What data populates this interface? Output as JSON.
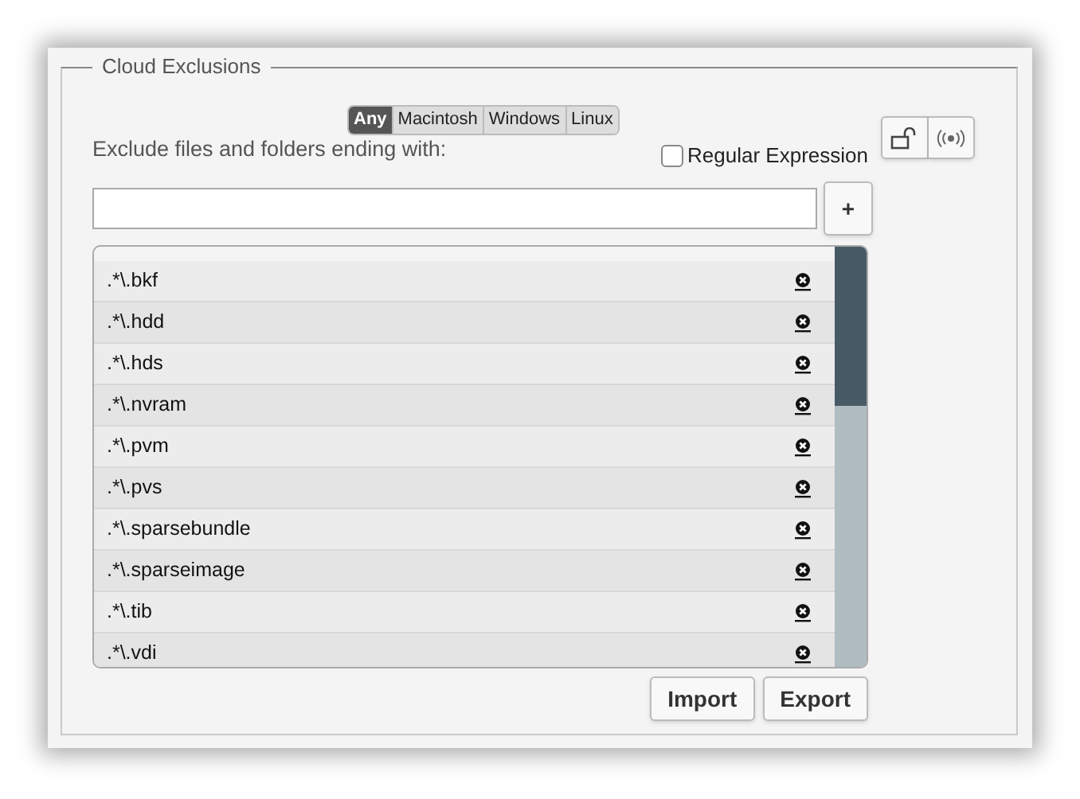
{
  "panel": {
    "title": "Cloud Exclusions"
  },
  "platform_tabs": [
    {
      "label": "Any",
      "selected": true
    },
    {
      "label": "Macintosh",
      "selected": false
    },
    {
      "label": "Windows",
      "selected": false
    },
    {
      "label": "Linux",
      "selected": false
    }
  ],
  "label": "Exclude files and folders ending with:",
  "regular_expression": {
    "label": "Regular Expression",
    "checked": false
  },
  "add_button": "+",
  "exclusions": [
    ".*\\.bkf",
    ".*\\.hdd",
    ".*\\.hds",
    ".*\\.nvram",
    ".*\\.pvm",
    ".*\\.pvs",
    ".*\\.sparsebundle",
    ".*\\.sparseimage",
    ".*\\.tib",
    ".*\\.vdi"
  ],
  "buttons": [
    "Import",
    "Export"
  ]
}
